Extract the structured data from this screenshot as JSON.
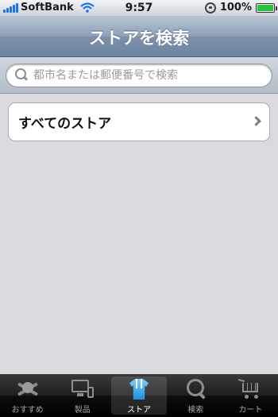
{
  "status_bar": {
    "carrier": "SoftBank",
    "time": "9:57",
    "battery": "100%"
  },
  "nav": {
    "title": "ストアを検索"
  },
  "search": {
    "placeholder": "都市名または郵便番号で検索"
  },
  "stores": {
    "all_label": "すべてのストア"
  },
  "tab_bar": {
    "tabs": [
      {
        "label": "おすすめ",
        "icon": "recommend-icon"
      },
      {
        "label": "製品",
        "icon": "products-icon"
      },
      {
        "label": "ストア",
        "icon": "store-icon",
        "active": true
      },
      {
        "label": "検索",
        "icon": "search-icon"
      },
      {
        "label": "カート",
        "icon": "cart-icon"
      }
    ]
  },
  "colors": {
    "nav_bar": "#8ea0b8",
    "battery_fill": "#27c43b",
    "signal": "#1a73e8",
    "tab_bar": "#1e1e1e"
  }
}
